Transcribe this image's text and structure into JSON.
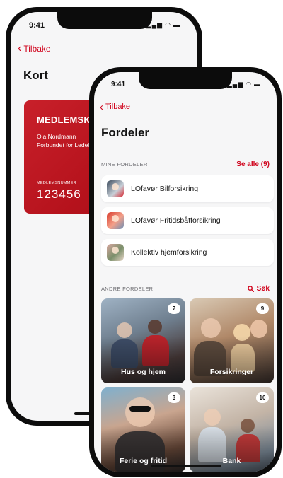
{
  "back_phone": {
    "status_time": "9:41",
    "back_label": "Tilbake",
    "title": "Kort",
    "card": {
      "title": "MEDLEMSKORT",
      "name": "Ola Nordmann",
      "organization": "Forbundet for Ledelse",
      "number_label": "MEDLEMSNUMMER",
      "number": "123456"
    }
  },
  "front_phone": {
    "status_time": "9:41",
    "back_label": "Tilbake",
    "title": "Fordeler",
    "my_benefits": {
      "label": "MINE FORDELER",
      "action": "Se alle (9)",
      "items": [
        {
          "name": "LOfavør Bilforsikring"
        },
        {
          "name": "LOfavør Fritidsbåtforsikring"
        },
        {
          "name": "Kollektiv hjemforsikring"
        }
      ]
    },
    "other_benefits": {
      "label": "ANDRE FORDELER",
      "search_label": "Søk",
      "tiles": [
        {
          "label": "Hus og hjem",
          "count": "7"
        },
        {
          "label": "Forsikringer",
          "count": "9"
        },
        {
          "label": "Ferie og fritid",
          "count": "3"
        },
        {
          "label": "Bank",
          "count": "10"
        }
      ]
    }
  },
  "colors": {
    "accent": "#d0021b",
    "card_red": "#c8202a",
    "background": "#f6f6f7"
  }
}
